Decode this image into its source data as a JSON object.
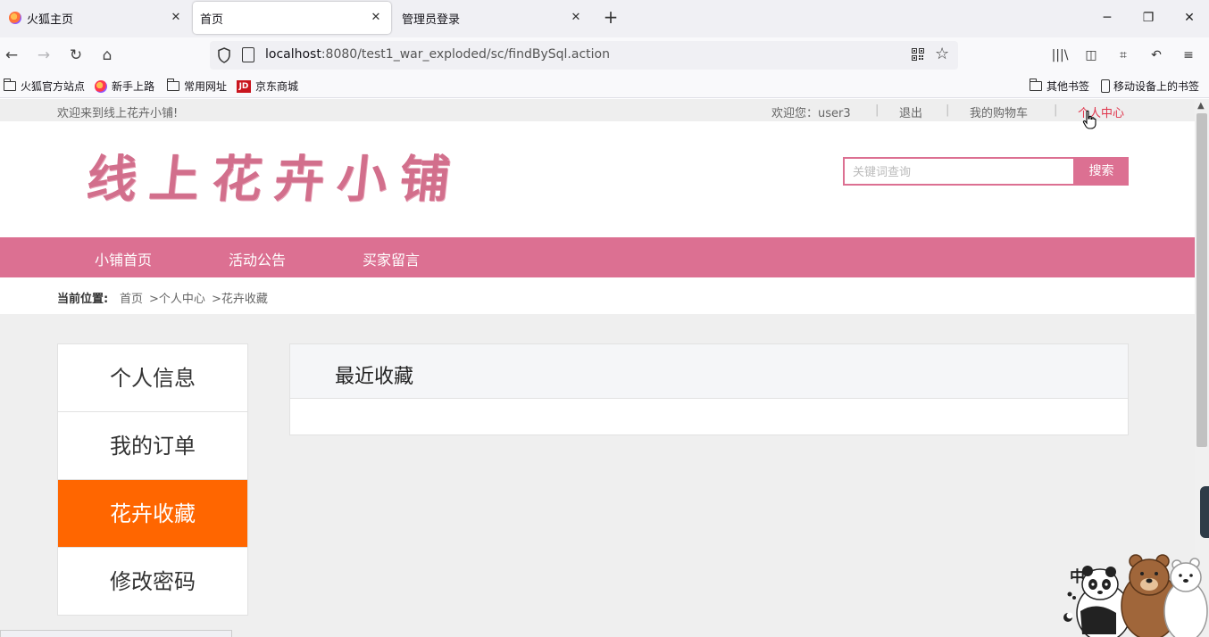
{
  "browser": {
    "tabs": [
      {
        "label": "火狐主页",
        "active": false
      },
      {
        "label": "首页",
        "active": true
      },
      {
        "label": "管理员登录",
        "active": false
      }
    ],
    "url_host": "localhost",
    "url_rest": ":8080/test1_war_exploded/sc/findBySql.action",
    "bookmarks": [
      "火狐官方站点",
      "新手上路",
      "常用网址",
      "京东商城"
    ],
    "bookmarks_right": [
      "其他书签",
      "移动设备上的书签"
    ]
  },
  "site": {
    "top": {
      "welcome": "欢迎来到线上花卉小铺!",
      "greeting": "欢迎您：user3",
      "logout": "退出",
      "cart": "我的购物车",
      "center": "个人中心"
    },
    "logo_text": "线上花卉小铺",
    "search": {
      "placeholder": "关键词查询",
      "button": "搜索"
    },
    "nav": [
      "小铺首页",
      "活动公告",
      "买家留言"
    ],
    "breadcrumb": {
      "label": "当前位置:",
      "items": [
        "首页",
        ">个人中心",
        ">花卉收藏"
      ]
    },
    "sidebar": [
      {
        "label": "个人信息",
        "active": false
      },
      {
        "label": "我的订单",
        "active": false
      },
      {
        "label": "花卉收藏",
        "active": true
      },
      {
        "label": "修改密码",
        "active": false
      }
    ],
    "panel": {
      "title": "最近收藏"
    },
    "mascot_char": "中"
  },
  "colors": {
    "brand_pink": "#dc7092",
    "active_orange": "#ff6600",
    "link_red": "#e0344b"
  }
}
